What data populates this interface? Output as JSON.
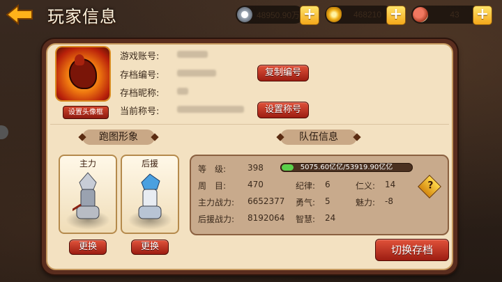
{
  "header": {
    "title": "玩家信息"
  },
  "resources": [
    {
      "name": "silver",
      "icon": "silver-coin-icon",
      "value": "48950.90万"
    },
    {
      "name": "gold",
      "icon": "gold-ingot-icon",
      "value": "468210"
    },
    {
      "name": "meat",
      "icon": "meat-icon",
      "value": "43"
    }
  ],
  "profile": {
    "avatar_button": "设置头像框",
    "labels": {
      "account": "游戏账号:",
      "save_id": "存档编号:",
      "nickname": "存档昵称:",
      "title": "当前称号:"
    },
    "copy_button": "复制编号",
    "set_title_button": "设置称号"
  },
  "sections": {
    "appearance": "跑图形象",
    "team": "队伍信息"
  },
  "heroes": [
    {
      "role": "主力",
      "exchange": "更换"
    },
    {
      "role": "后援",
      "exchange": "更换"
    }
  ],
  "team": {
    "level_label": "等　级:",
    "level": "398",
    "exp_text": "5075.60亿亿/53919.90亿亿",
    "exp_fraction": 0.094,
    "round_label": "周　目:",
    "round": "470",
    "discipline_label": "纪律:",
    "discipline": "6",
    "benevolence_label": "仁义:",
    "benevolence": "14",
    "main_power_label": "主力战力:",
    "main_power": "6652377",
    "courage_label": "勇气:",
    "courage": "5",
    "charm_label": "魅力:",
    "charm": "-8",
    "support_power_label": "后援战力:",
    "support_power": "8192064",
    "wisdom_label": "智慧:",
    "wisdom": "24"
  },
  "switch_button": "切换存档"
}
